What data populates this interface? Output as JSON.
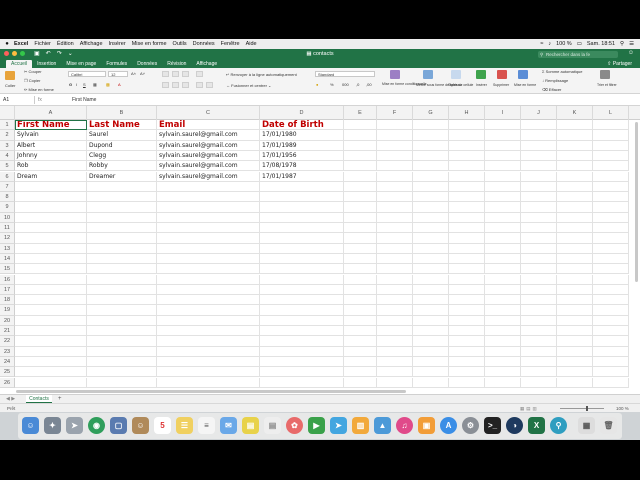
{
  "menubar": {
    "apple": "",
    "items": [
      "Excel",
      "Fichier",
      "Édition",
      "Affichage",
      "Insérer",
      "Mise en forme",
      "Outils",
      "Données",
      "Fenêtre",
      "Aide"
    ],
    "battery": "100 %",
    "clock": "Sam. 18:51"
  },
  "titlebar": {
    "document": "contacts",
    "search_placeholder": "Rechercher dans la fe",
    "user_icon": "person-icon"
  },
  "ribbon_tabs": {
    "items": [
      "Accueil",
      "Insertion",
      "Mise en page",
      "Formules",
      "Données",
      "Révision",
      "Affichage"
    ],
    "active": "Accueil",
    "share": "Partager"
  },
  "ribbon": {
    "paste": "Coller",
    "cut": "Couper",
    "copy": "Copier",
    "format": "Mise en forme",
    "font_name": "Calibri",
    "font_size": "12",
    "wrap": "Renvoyer à la ligne automatiquement",
    "merge": "Fusionner et centrer",
    "number_format": "Standard",
    "cond_format": "Mise en forme conditionnelle",
    "table_format": "Mettre sous forme de tableau",
    "cell_styles": "Styles de cellule",
    "insert": "Insérer",
    "delete": "Supprimer",
    "format_cells": "Mise en forme",
    "autosum": "Somme automatique",
    "fill": "Remplissage",
    "clear": "Effacer",
    "sort": "Trier et filtrer",
    "colors": {
      "accent": "#217346",
      "header_text": "#c00000"
    }
  },
  "formula_bar": {
    "name_box": "A1",
    "fx": "fx",
    "value": "First Name"
  },
  "sheet": {
    "columns": [
      "A",
      "B",
      "C",
      "D",
      "E",
      "F",
      "G",
      "H",
      "I",
      "J",
      "K",
      "L"
    ],
    "rows": [
      "1",
      "2",
      "3",
      "4",
      "5",
      "6",
      "7",
      "8",
      "9",
      "10",
      "11",
      "12",
      "13",
      "14",
      "15",
      "16",
      "17",
      "18",
      "19",
      "20",
      "21",
      "22",
      "23",
      "24",
      "25",
      "26"
    ],
    "headers": [
      "First Name",
      "Last Name",
      "Email",
      "Date of Birth"
    ],
    "data": [
      [
        "Sylvain",
        "Saurel",
        "sylvain.saurel@gmail.com",
        "17/01/1980"
      ],
      [
        "Albert",
        "Dupond",
        "sylvain.saurel@gmail.com",
        "17/01/1989"
      ],
      [
        "Johnny",
        "Clegg",
        "sylvain.saurel@gmail.com",
        "17/01/1956"
      ],
      [
        "Rob",
        "Robby",
        "sylvain.saurel@gmail.com",
        "17/08/1978"
      ],
      [
        "Dream",
        "Dreamer",
        "sylvain.saurel@gmail.com",
        "17/01/1987"
      ]
    ]
  },
  "sheet_tabs": {
    "active": "Contacts",
    "add": "+"
  },
  "status": {
    "ready": "Prêt",
    "zoom": "100 %"
  },
  "dock": {
    "calendar_day": "5"
  }
}
